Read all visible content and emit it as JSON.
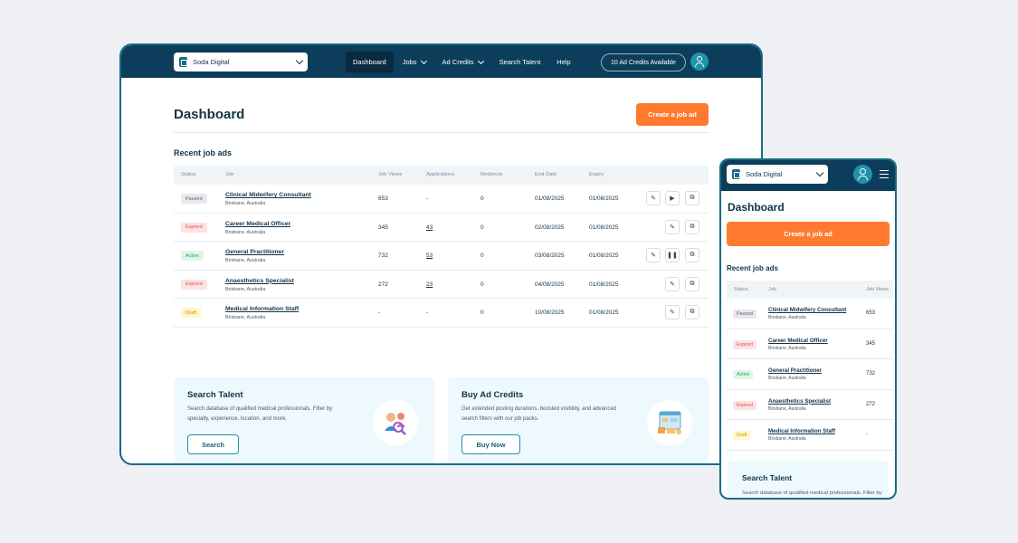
{
  "desktop": {
    "org_name": "Soda Digital",
    "nav": {
      "dashboard": "Dashboard",
      "jobs": "Jobs",
      "ad_credits": "Ad Credits",
      "search_talent": "Search Talent",
      "help": "Help"
    },
    "credits_pill": "10 Ad Credits Available",
    "title": "Dashboard",
    "create_button": "Create a job ad",
    "recent_heading": "Recent job ads",
    "columns": [
      "Status",
      "Job",
      "Job Views",
      "Applications",
      "Redirects",
      "End Date",
      "Expiry"
    ],
    "rows": [
      {
        "status": "Paused",
        "title": "Clinical Midwifery Consultant",
        "location": "Brisbane, Australia",
        "views": "653",
        "applications": "-",
        "redirects": "0",
        "end_date": "01/08/2025",
        "expiry": "01/08/2025"
      },
      {
        "status": "Expired",
        "title": "Career Medical Officer",
        "location": "Brisbane, Australia",
        "views": "345",
        "applications": "43",
        "redirects": "0",
        "end_date": "02/08/2025",
        "expiry": "01/08/2025"
      },
      {
        "status": "Active",
        "title": "General Practitioner",
        "location": "Brisbane, Australia",
        "views": "732",
        "applications": "53",
        "redirects": "0",
        "end_date": "03/08/2025",
        "expiry": "01/08/2025"
      },
      {
        "status": "Expired",
        "title": "Anaesthetics Specialist",
        "location": "Brisbane, Australia",
        "views": "272",
        "applications": "23",
        "redirects": "0",
        "end_date": "04/08/2025",
        "expiry": "01/08/2025"
      },
      {
        "status": "Draft",
        "title": "Medical Information Staff",
        "location": "Brisbane, Australia",
        "views": "-",
        "applications": "-",
        "redirects": "0",
        "end_date": "10/08/2025",
        "expiry": "01/08/2025"
      }
    ],
    "cards": {
      "search": {
        "title": "Search Talent",
        "body": "Search database of qualified medical professionals. Filter by specialty, experience, location, and more.",
        "button": "Search"
      },
      "buy": {
        "title": "Buy Ad Credits",
        "body": "Get extended posting durations, boosted visibility, and advanced search filters with our job packs.",
        "button": "Buy Now"
      }
    }
  },
  "mobile": {
    "org_name": "Soda Digital",
    "title": "Dashboard",
    "create_button": "Create a job ad",
    "recent_heading": "Recent job ads",
    "columns": [
      "Status",
      "Job",
      "Job Views"
    ],
    "rows": [
      {
        "status": "Paused",
        "title": "Clinical Midwifery Consultant",
        "location": "Brisbane, Australia",
        "views": "653"
      },
      {
        "status": "Expired",
        "title": "Career Medical Officer",
        "location": "Brisbane, Australia",
        "views": "345"
      },
      {
        "status": "Active",
        "title": "General Practitioner",
        "location": "Brisbane, Australia",
        "views": "732"
      },
      {
        "status": "Expired",
        "title": "Anaesthetics Specialist",
        "location": "Brisbane, Australia",
        "views": "272"
      },
      {
        "status": "Draft",
        "title": "Medical Information Staff",
        "location": "Brisbane, Australia",
        "views": "-"
      }
    ],
    "card": {
      "title": "Search Talent",
      "body": "Search database of qualified medical professionals. Filter by specialty, experience, location, and more."
    }
  },
  "colors": {
    "nav_bg": "#0c3d5a",
    "accent": "#ff7a2f",
    "teal": "#1f93ad",
    "card_bg": "#eef9fd"
  }
}
